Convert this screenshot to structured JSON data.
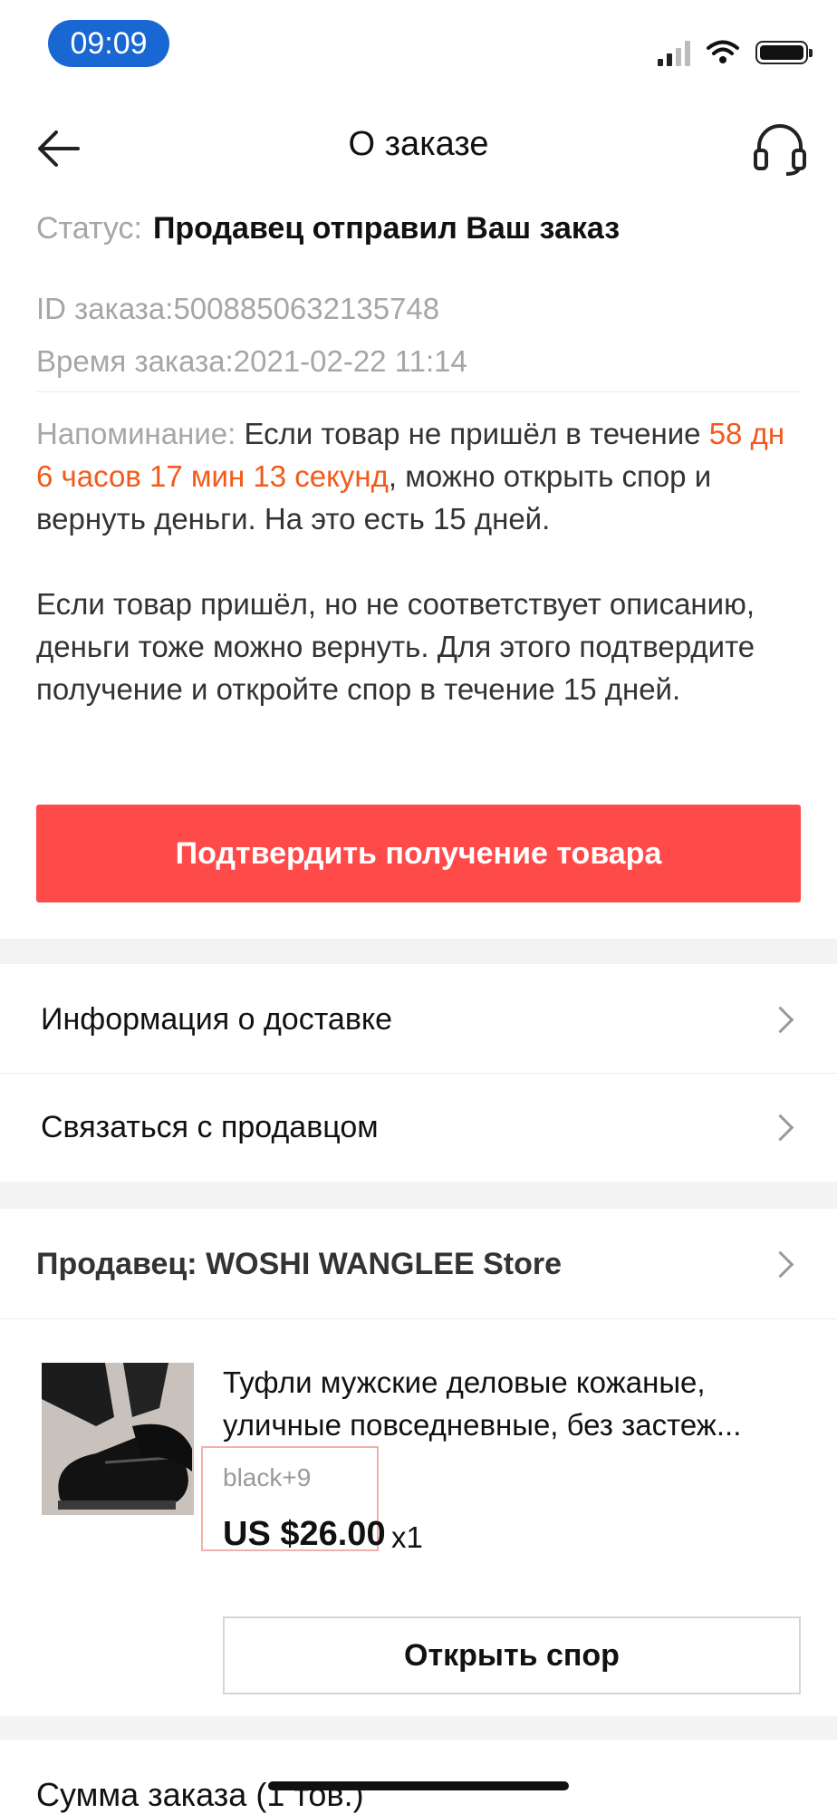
{
  "status_bar": {
    "time": "09:09"
  },
  "header": {
    "title": "О заказе",
    "back_icon": "arrow-left-icon",
    "support_icon": "headset-icon"
  },
  "order": {
    "status_label": "Статус:",
    "status_value": "Продавец отправил Ваш заказ",
    "id_label": "ID заказа:",
    "id_value": "5008850632135748",
    "time_label": "Время заказа:",
    "time_value": "2021-02-22 11:14"
  },
  "reminder": {
    "label": "Напоминание:",
    "text_before": " Если товар не пришёл в течение ",
    "countdown": "58 дн 6 часов 17 мин 13 секунд",
    "text_after": ", можно открыть спор и вернуть деньги. На это есть 15 дней.",
    "paragraph2": "Если товар пришёл, но не соответствует описанию, деньги тоже можно вернуть. Для этого подтвердите получение и откройте спор в течение 15 дней."
  },
  "confirm_button": "Подтвердить получение товара",
  "menu": {
    "delivery_info": "Информация о доставке",
    "contact_seller": "Связаться с продавцом"
  },
  "seller": {
    "label": "Продавец:",
    "name": "WOSHI WANGLEE Store"
  },
  "product": {
    "title_line1": "Туфли мужские деловые кожаные,",
    "title_line2": "уличные повседневные, без застеж...",
    "sku": "black+9",
    "price": "US $26.00",
    "quantity": "x1"
  },
  "dispute_button": "Открыть спор",
  "summary": {
    "label": "Сумма заказа (1 тов.)"
  },
  "colors": {
    "accent_red": "#ff4a4a",
    "countdown_orange": "#f25a1c",
    "status_time_bg": "#1967d2"
  }
}
